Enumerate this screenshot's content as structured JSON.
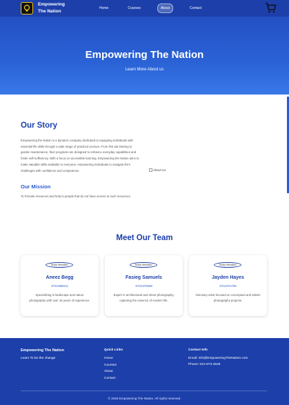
{
  "nav": {
    "brand": "Empowering The Nation",
    "links": [
      "Home",
      "Courses",
      "About",
      "Contact"
    ],
    "active": "About"
  },
  "hero": {
    "title": "Empowering The Nation",
    "subtitle": "Learn More About us"
  },
  "story": {
    "title": "Our Story",
    "body": "Empowering the Nation is a dynamic company dedicated to equipping individuals with essential life skills through a wide range of practical courses. From first aid training to garden maintenance, their programs are designed to enhance everyday capabilities and foster self-sufficiency. With a focus on accessible learning, Empowering the Nation aims to make valuable skills available to everyone, empowering individuals to navigate life's challenges with confidence and competence.",
    "mission_title": "Our Mission",
    "mission_body": "To Provide resources and help to people that do not have access to such resources.",
    "image_alt": "About Us"
  },
  "team": {
    "title": "Meet Our Team",
    "members": [
      {
        "name": "Aneez Begg",
        "id": "ST10466012",
        "desc": "Specializing in landscape and nature photography with over 15 years of experience.",
        "image_alt": "Team Member"
      },
      {
        "name": "Fasieg Samuels",
        "id": "ST10476528",
        "desc": "Expert in architectural and street photography, capturing the essence of modern life.",
        "image_alt": "Team Member"
      },
      {
        "name": "Jayden Hayes",
        "id": "ST10474705",
        "desc": "Visionary artist focused on conceptual and artistic photography projects.",
        "image_alt": "Team Member"
      }
    ]
  },
  "footer": {
    "brand": "Empowering The Nation",
    "tagline": "Learn To be the change",
    "quick_links_title": "Quick Links",
    "quick_links": [
      "Home",
      "Courses",
      "About",
      "Contact"
    ],
    "contact_title": "Contact Info",
    "email": "Email: info@EmpoweringTheNation.com",
    "phone": "Phone: 021-673-4528",
    "copyright": "© 2025 Empowering The Nation. All rights reserved."
  },
  "colors": {
    "primary": "#1c3faa",
    "accent": "#2a5bd0",
    "logo_ring": "#f5c518"
  }
}
